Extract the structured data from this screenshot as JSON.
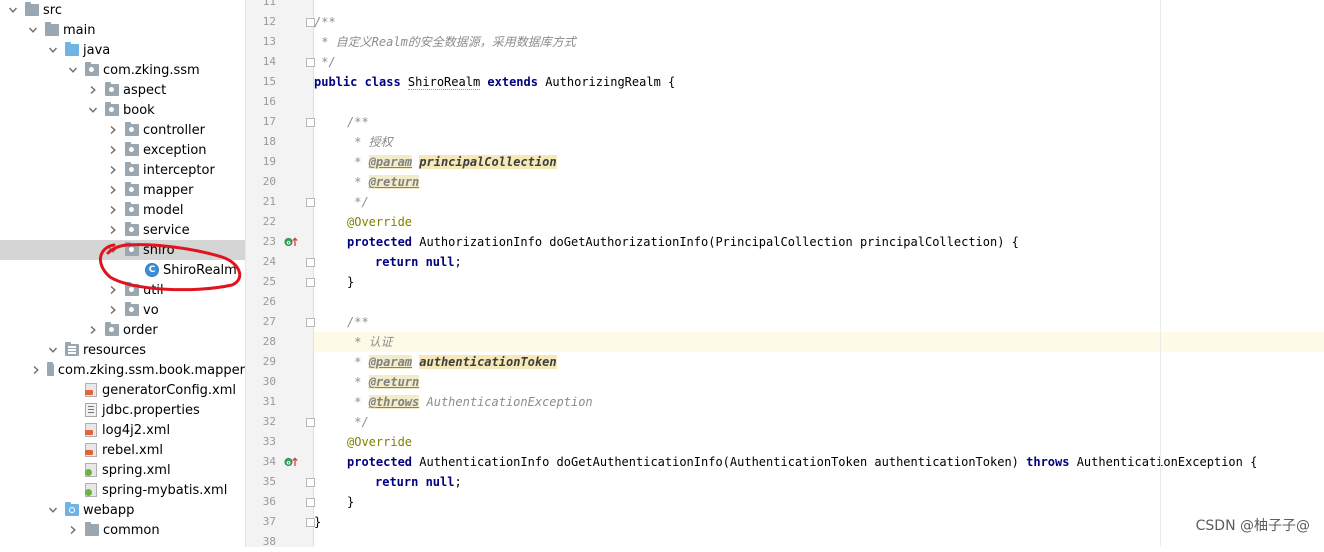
{
  "tree": {
    "items": [
      {
        "label": "src",
        "depth": 0,
        "icon": "folder-icon",
        "expanded": true
      },
      {
        "label": "main",
        "depth": 1,
        "icon": "folder-icon",
        "expanded": true
      },
      {
        "label": "java",
        "depth": 2,
        "icon": "source-folder-icon",
        "expanded": true
      },
      {
        "label": "com.zking.ssm",
        "depth": 3,
        "icon": "package-icon",
        "expanded": true
      },
      {
        "label": "aspect",
        "depth": 4,
        "icon": "package-icon",
        "expanded": false
      },
      {
        "label": "book",
        "depth": 4,
        "icon": "package-icon",
        "expanded": true
      },
      {
        "label": "controller",
        "depth": 5,
        "icon": "package-icon",
        "expanded": false
      },
      {
        "label": "exception",
        "depth": 5,
        "icon": "package-icon",
        "expanded": false
      },
      {
        "label": "interceptor",
        "depth": 5,
        "icon": "package-icon",
        "expanded": false
      },
      {
        "label": "mapper",
        "depth": 5,
        "icon": "package-icon",
        "expanded": false
      },
      {
        "label": "model",
        "depth": 5,
        "icon": "package-icon",
        "expanded": false
      },
      {
        "label": "service",
        "depth": 5,
        "icon": "package-icon",
        "expanded": false
      },
      {
        "label": "shiro",
        "depth": 5,
        "icon": "package-icon",
        "expanded": true,
        "selected": true
      },
      {
        "label": "ShiroRealm",
        "depth": 6,
        "icon": "class-icon",
        "leaf": true
      },
      {
        "label": "util",
        "depth": 5,
        "icon": "package-icon",
        "expanded": false
      },
      {
        "label": "vo",
        "depth": 5,
        "icon": "package-icon",
        "expanded": false
      },
      {
        "label": "order",
        "depth": 4,
        "icon": "package-icon",
        "expanded": false
      },
      {
        "label": "resources",
        "depth": 2,
        "icon": "resources-folder-icon",
        "expanded": true
      },
      {
        "label": "com.zking.ssm.book.mapper",
        "depth": 3,
        "icon": "folder-icon",
        "expanded": false
      },
      {
        "label": "generatorConfig.xml",
        "depth": 3,
        "icon": "xml-file-icon",
        "leaf": true
      },
      {
        "label": "jdbc.properties",
        "depth": 3,
        "icon": "properties-file-icon",
        "leaf": true
      },
      {
        "label": "log4j2.xml",
        "depth": 3,
        "icon": "xml-file-icon",
        "leaf": true
      },
      {
        "label": "rebel.xml",
        "depth": 3,
        "icon": "xml-file-icon",
        "leaf": true
      },
      {
        "label": "spring.xml",
        "depth": 3,
        "icon": "spring-xml-file-icon",
        "leaf": true
      },
      {
        "label": "spring-mybatis.xml",
        "depth": 3,
        "icon": "spring-xml-file-icon",
        "leaf": true
      },
      {
        "label": "webapp",
        "depth": 2,
        "icon": "web-folder-icon",
        "expanded": true
      },
      {
        "label": "common",
        "depth": 3,
        "icon": "folder-icon",
        "expanded": false
      }
    ]
  },
  "editor": {
    "lines": [
      {
        "n": "11",
        "segs": []
      },
      {
        "n": "12",
        "segs": [
          {
            "t": "/**",
            "c": "cm"
          }
        ]
      },
      {
        "n": "13",
        "segs": [
          {
            "t": " * 自定义Realm的安全数据源，采用数据库方式",
            "c": "cm"
          }
        ]
      },
      {
        "n": "14",
        "segs": [
          {
            "t": " */",
            "c": "cm"
          }
        ]
      },
      {
        "n": "15",
        "segs": [
          {
            "t": "public class ",
            "c": "kw"
          },
          {
            "t": "ShiroRealm",
            "c": "cls-under"
          },
          {
            "t": " extends ",
            "c": "kw"
          },
          {
            "t": "AuthorizingRealm {",
            "c": ""
          }
        ]
      },
      {
        "n": "16",
        "segs": []
      },
      {
        "n": "17",
        "ind": 1,
        "segs": [
          {
            "t": "/**",
            "c": "cm"
          }
        ]
      },
      {
        "n": "18",
        "ind": 1,
        "segs": [
          {
            "t": " * 授权",
            "c": "cm"
          }
        ]
      },
      {
        "n": "19",
        "ind": 1,
        "segs": [
          {
            "t": " * ",
            "c": "cm"
          },
          {
            "t": "@param",
            "c": "tagk"
          },
          {
            "t": " ",
            "c": "cm"
          },
          {
            "t": "principalCollection",
            "c": "tagv"
          }
        ]
      },
      {
        "n": "20",
        "ind": 1,
        "segs": [
          {
            "t": " * ",
            "c": "cm"
          },
          {
            "t": "@return",
            "c": "tagk"
          }
        ]
      },
      {
        "n": "21",
        "ind": 1,
        "segs": [
          {
            "t": " */",
            "c": "cm"
          }
        ]
      },
      {
        "n": "22",
        "ind": 1,
        "segs": [
          {
            "t": "@Override",
            "c": "anno"
          }
        ]
      },
      {
        "n": "23",
        "ind": 1,
        "mark": "override",
        "segs": [
          {
            "t": "protected ",
            "c": "kw"
          },
          {
            "t": "AuthorizationInfo doGetAuthorizationInfo(PrincipalCollection principalCollection) {",
            "c": ""
          }
        ]
      },
      {
        "n": "24",
        "ind": 2,
        "segs": [
          {
            "t": "return null",
            "c": "kw"
          },
          {
            "t": ";",
            "c": ""
          }
        ]
      },
      {
        "n": "25",
        "ind": 1,
        "segs": [
          {
            "t": "}",
            "c": ""
          }
        ]
      },
      {
        "n": "26",
        "segs": []
      },
      {
        "n": "27",
        "ind": 1,
        "segs": [
          {
            "t": "/**",
            "c": "cm"
          }
        ]
      },
      {
        "n": "28",
        "ind": 1,
        "hl": true,
        "segs": [
          {
            "t": " * 认证",
            "c": "cm"
          }
        ]
      },
      {
        "n": "29",
        "ind": 1,
        "segs": [
          {
            "t": " * ",
            "c": "cm"
          },
          {
            "t": "@param",
            "c": "tagk"
          },
          {
            "t": " ",
            "c": "cm"
          },
          {
            "t": "authenticationToken",
            "c": "tagv"
          }
        ]
      },
      {
        "n": "30",
        "ind": 1,
        "segs": [
          {
            "t": " * ",
            "c": "cm"
          },
          {
            "t": "@return",
            "c": "tagk"
          }
        ]
      },
      {
        "n": "31",
        "ind": 1,
        "segs": [
          {
            "t": " * ",
            "c": "cm"
          },
          {
            "t": "@throws",
            "c": "tagk"
          },
          {
            "t": " AuthenticationException",
            "c": "cm"
          }
        ]
      },
      {
        "n": "32",
        "ind": 1,
        "segs": [
          {
            "t": " */",
            "c": "cm"
          }
        ]
      },
      {
        "n": "33",
        "ind": 1,
        "segs": [
          {
            "t": "@Override",
            "c": "anno"
          }
        ]
      },
      {
        "n": "34",
        "ind": 1,
        "mark": "override",
        "segs": [
          {
            "t": "protected ",
            "c": "kw"
          },
          {
            "t": "AuthenticationInfo doGetAuthenticationInfo(AuthenticationToken authenticationToken) ",
            "c": ""
          },
          {
            "t": "throws ",
            "c": "kw"
          },
          {
            "t": "AuthenticationException {",
            "c": ""
          }
        ]
      },
      {
        "n": "35",
        "ind": 2,
        "segs": [
          {
            "t": "return null",
            "c": "kw"
          },
          {
            "t": ";",
            "c": ""
          }
        ]
      },
      {
        "n": "36",
        "ind": 1,
        "segs": [
          {
            "t": "}",
            "c": ""
          }
        ]
      },
      {
        "n": "37",
        "segs": [
          {
            "t": "}",
            "c": ""
          }
        ]
      },
      {
        "n": "38",
        "segs": []
      }
    ]
  },
  "watermark": "CSDN @柚子子@",
  "colors": {
    "annotation_circle": "#e0141e",
    "keyword": "#000080",
    "comment": "#8c8c8c",
    "annotation": "#808000",
    "selection": "#d5d5d5"
  }
}
